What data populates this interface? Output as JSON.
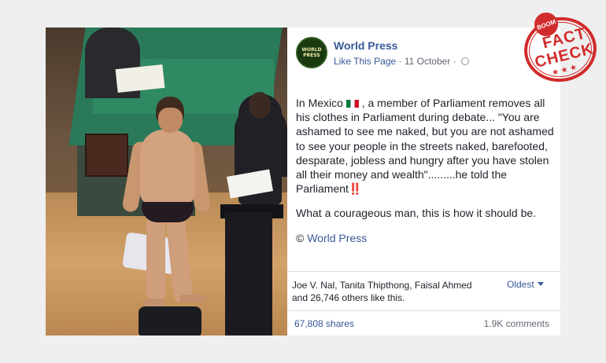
{
  "post": {
    "page_name": "World Press",
    "avatar_text": "WORLD PRESS",
    "like_link": "Like This Page",
    "separator": " · ",
    "date": "11 October",
    "separator2": " · ",
    "paragraph1_a": "In Mexico ",
    "paragraph1_b": " , a member of Parliament removes all his clothes in Parliament during debate... \"You are ashamed to see me naked, but you are not ashamed to see your people in the streets naked, barefooted, desparate, jobless and hungry after you have stolen all their money and wealth\".........he told the Parliament",
    "bang": "‼️",
    "paragraph2": "What a courageous man, this is how it should be.",
    "credit_prefix": "© ",
    "credit_link": "World Press",
    "likes_text": "Joe V. Nal, Tanita Thipthong, Faisal Ahmed and 26,746 others like this.",
    "sort_label": "Oldest",
    "shares": "67,808 shares",
    "comments": "1.9K comments"
  },
  "stamp": {
    "boom": "BOOM",
    "fact": "FACT",
    "check": "CHECK",
    "stars": "★ ★ ★"
  },
  "colors": {
    "fb_link": "#385898",
    "stamp_red": "#d12b2b"
  }
}
